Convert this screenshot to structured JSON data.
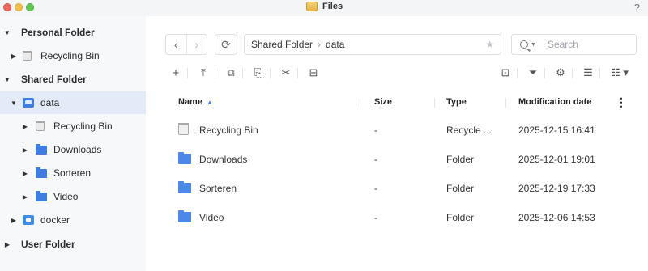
{
  "window": {
    "title": "Files",
    "help_label": "?"
  },
  "sidebar": {
    "personal": {
      "label": "Personal Folder",
      "recycle": "Recycling Bin"
    },
    "shared": {
      "label": "Shared Folder",
      "data": {
        "label": "data",
        "children": [
          "Recycling Bin",
          "Downloads",
          "Sorteren",
          "Video"
        ]
      },
      "docker": "docker"
    },
    "user": {
      "label": "User Folder"
    }
  },
  "nav": {
    "back": "‹",
    "forward": "›",
    "refresh": "⟳"
  },
  "path": {
    "segments": [
      "Shared Folder",
      "data"
    ],
    "separator": "›"
  },
  "search": {
    "placeholder": "Search"
  },
  "table": {
    "headers": {
      "name": "Name",
      "size": "Size",
      "type": "Type",
      "modified": "Modification date"
    },
    "rows": [
      {
        "name": "Recycling Bin",
        "size": "-",
        "type": "Recycle ...",
        "modified": "2025-12-15 16:41",
        "icon": "recycle-bin-icon"
      },
      {
        "name": "Downloads",
        "size": "-",
        "type": "Folder",
        "modified": "2025-12-01 19:01",
        "icon": "folder-icon"
      },
      {
        "name": "Sorteren",
        "size": "-",
        "type": "Folder",
        "modified": "2025-12-19 17:33",
        "icon": "folder-icon"
      },
      {
        "name": "Video",
        "size": "-",
        "type": "Folder",
        "modified": "2025-12-06 14:53",
        "icon": "folder-icon"
      }
    ]
  },
  "colors": {
    "accent": "#3f7ddf",
    "selected_bg": "#e3ebf8"
  }
}
